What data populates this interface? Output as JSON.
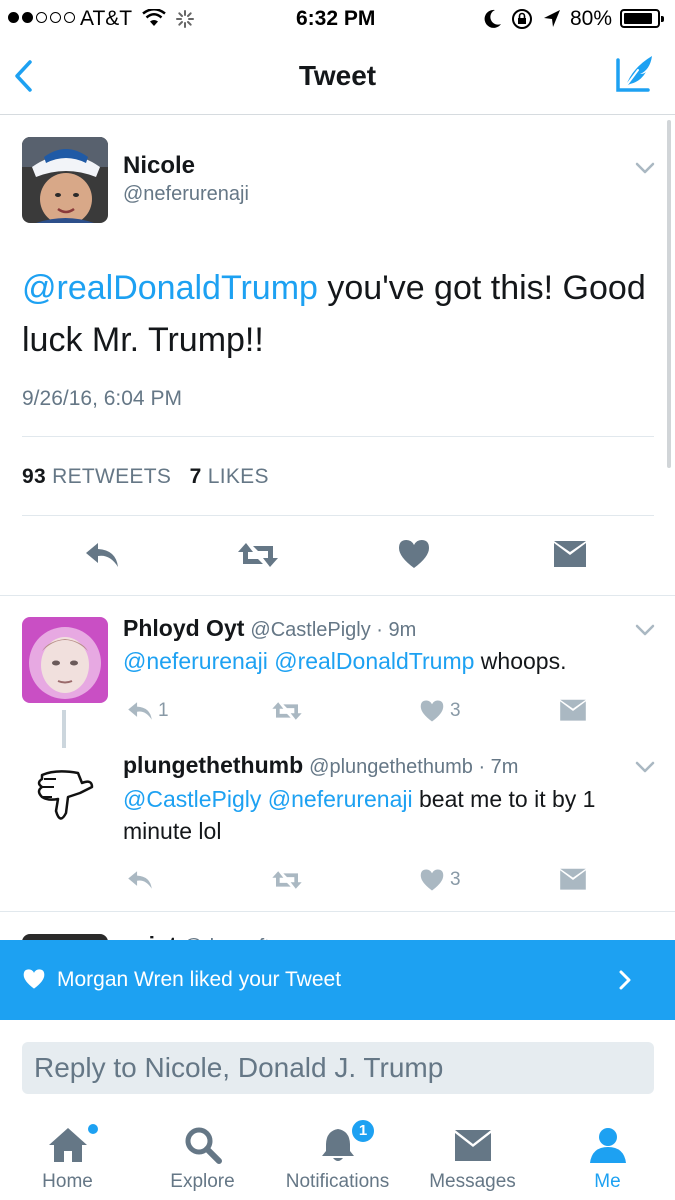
{
  "status_bar": {
    "carrier": "AT&T",
    "time": "6:32 PM",
    "battery": "80%"
  },
  "nav": {
    "title": "Tweet"
  },
  "main_tweet": {
    "name": "Nicole",
    "handle": "@neferurenaji",
    "mention": "@realDonaldTrump",
    "text": " you've got this!  Good luck Mr. Trump!!",
    "timestamp": "9/26/16, 6:04 PM",
    "retweet_count": "93",
    "retweet_label": "RETWEETS",
    "like_count": "7",
    "like_label": "LIKES"
  },
  "replies": [
    {
      "name": "Phloyd Oyt",
      "handle": "@CastlePigly · 9m",
      "mention1": "@neferurenaji",
      "mention2": "@realDonaldTrump",
      "text": " whoops.",
      "reply_count": "1",
      "like_count": "3"
    },
    {
      "name": "plungethethumb",
      "handle": "@plungethethumb · 7m",
      "mention1": "@CastlePigly",
      "mention2": "@neferurenaji",
      "text": " beat me to it by 1 minute lol",
      "like_count": "3"
    }
  ],
  "peek_reply": {
    "name": "saint",
    "handle": "@dunnoftw"
  },
  "notification": {
    "text": "Morgan Wren liked your Tweet"
  },
  "reply_box": {
    "placeholder": "Reply to Nicole, Donald J. Trump"
  },
  "tabs": [
    {
      "label": "Home"
    },
    {
      "label": "Explore"
    },
    {
      "label": "Notifications",
      "badge": "1"
    },
    {
      "label": "Messages"
    },
    {
      "label": "Me"
    }
  ],
  "colors": {
    "accent": "#1da1f2",
    "secondary_text": "#657786",
    "icon_gray": "#657786",
    "light_icon": "#8899a6"
  }
}
